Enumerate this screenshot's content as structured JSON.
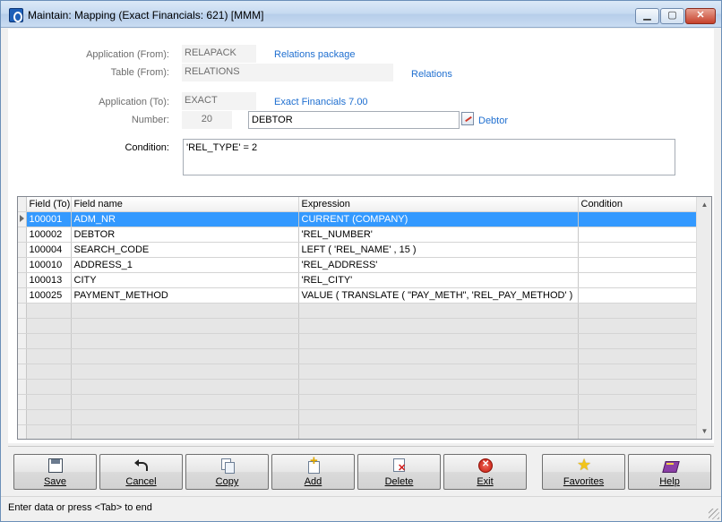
{
  "window": {
    "title": "Maintain: Mapping (Exact Financials: 621) [MMM]",
    "min_glyph": "▁",
    "max_glyph": "▢",
    "close_glyph": "✕"
  },
  "form": {
    "app_from_label": "Application (From):",
    "app_from_value": "RELAPACK",
    "app_from_link": "Relations package",
    "table_from_label": "Table (From):",
    "table_from_value": "RELATIONS",
    "table_from_link": "Relations",
    "app_to_label": "Application (To):",
    "app_to_value": "EXACT",
    "app_to_link": "Exact Financials 7.00",
    "number_label": "Number:",
    "number_value": "20",
    "number_name": "DEBTOR",
    "number_link": "Debtor",
    "condition_label": "Condition:",
    "condition_value": "'REL_TYPE' = 2"
  },
  "grid": {
    "columns": [
      "Field (To)",
      "Field name",
      "Expression",
      "Condition"
    ],
    "rows": [
      {
        "field_to": "100001",
        "field_name": "ADM_NR",
        "expression": "CURRENT (COMPANY)",
        "condition": ""
      },
      {
        "field_to": "100002",
        "field_name": "DEBTOR",
        "expression": "'REL_NUMBER'",
        "condition": ""
      },
      {
        "field_to": "100004",
        "field_name": "SEARCH_CODE",
        "expression": "LEFT ( 'REL_NAME'  , 15 )",
        "condition": ""
      },
      {
        "field_to": "100010",
        "field_name": "ADDRESS_1",
        "expression": "'REL_ADDRESS'",
        "condition": ""
      },
      {
        "field_to": "100013",
        "field_name": "CITY",
        "expression": "'REL_CITY'",
        "condition": ""
      },
      {
        "field_to": "100025",
        "field_name": "PAYMENT_METHOD",
        "expression": "VALUE ( TRANSLATE ( \"PAY_METH\", 'REL_PAY_METHOD'  )",
        "condition": ""
      }
    ],
    "selected_row": 0,
    "empty_rows": 9,
    "scroll_up": "▲",
    "scroll_down": "▼"
  },
  "toolbar": {
    "save": "Save",
    "cancel": "Cancel",
    "copy": "Copy",
    "add": "Add",
    "delete": "Delete",
    "exit": "Exit",
    "favorites": "Favorites",
    "help": "Help"
  },
  "icons": {
    "save": "save-icon",
    "cancel": "undo-icon",
    "copy": "copy-icon",
    "add": "add-icon",
    "delete": "delete-icon",
    "exit": "exit-icon",
    "favorites": "star-icon",
    "help": "help-book-icon"
  },
  "status": {
    "text": "Enter data or press <Tab> to end"
  },
  "colors": {
    "selection": "#3399ff",
    "link": "#1f6fd0"
  }
}
